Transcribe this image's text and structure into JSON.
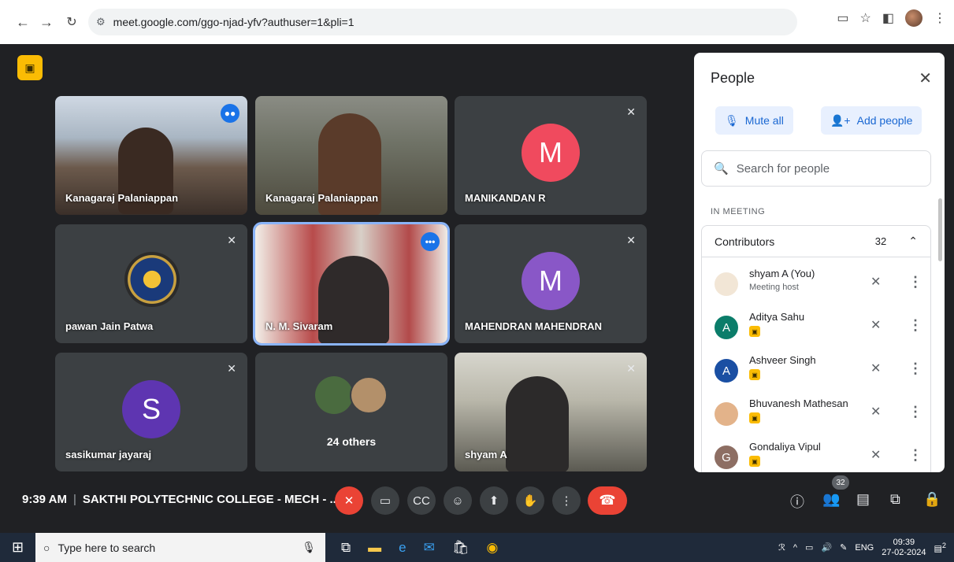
{
  "browser": {
    "url": "meet.google.com/ggo-njad-yfv?authuser=1&pli=1",
    "icons": [
      "back-icon",
      "forward-icon",
      "reload-icon",
      "site-info-icon",
      "cast-icon",
      "star-icon",
      "sidepanel-icon",
      "menu-icon"
    ]
  },
  "tiles": [
    {
      "name": "Kanagaraj Palaniappan",
      "kind": "video-a",
      "state": "speaking"
    },
    {
      "name": "Kanagaraj Palaniappan",
      "kind": "video-b",
      "state": "none"
    },
    {
      "name": "MANIKANDAN R",
      "kind": "avatar",
      "letter": "M",
      "color": "#f04a5e",
      "state": "muted"
    },
    {
      "name": "pawan Jain Patwa",
      "kind": "logo",
      "state": "muted"
    },
    {
      "name": "N. M. Sivaram",
      "kind": "video-c",
      "state": "more"
    },
    {
      "name": "MAHENDRAN MAHENDRAN",
      "kind": "avatar",
      "letter": "M",
      "color": "#8957c7",
      "state": "muted"
    },
    {
      "name": "sasikumar jayaraj",
      "kind": "avatar",
      "letter": "S",
      "color": "#5e35b1",
      "state": "muted"
    },
    {
      "name": "24 others",
      "kind": "others",
      "state": "none"
    },
    {
      "name": "shyam A",
      "kind": "video-d",
      "state": "muted"
    }
  ],
  "panel": {
    "title": "People",
    "mute_all": "Mute all",
    "add_people": "Add people",
    "search_placeholder": "Search for people",
    "section_label": "IN MEETING",
    "group_label": "Contributors",
    "group_count": "32",
    "participants": [
      {
        "name": "shyam A (You)",
        "sub": "Meeting host",
        "letter": "",
        "color": "#f2e6d6"
      },
      {
        "name": "Aditya Sahu",
        "sub": "",
        "letter": "A",
        "color": "#0b7d6a"
      },
      {
        "name": "Ashveer Singh",
        "sub": "",
        "letter": "A",
        "color": "#1a4fa3"
      },
      {
        "name": "Bhuvanesh Mathesan",
        "sub": "",
        "letter": "",
        "color": "#e3b38a"
      },
      {
        "name": "Gondaliya Vipul",
        "sub": "",
        "letter": "G",
        "color": "#8d6e63"
      }
    ]
  },
  "bottom": {
    "time": "9:39 AM",
    "meeting_name": "SAKTHI POLYTECHNIC COLLEGE - MECH - ...",
    "people_count": "32"
  },
  "taskbar": {
    "search_placeholder": "Type here to search",
    "lang": "ENG",
    "clock_time": "09:39",
    "clock_date": "27-02-2024",
    "notif_count": "2"
  }
}
